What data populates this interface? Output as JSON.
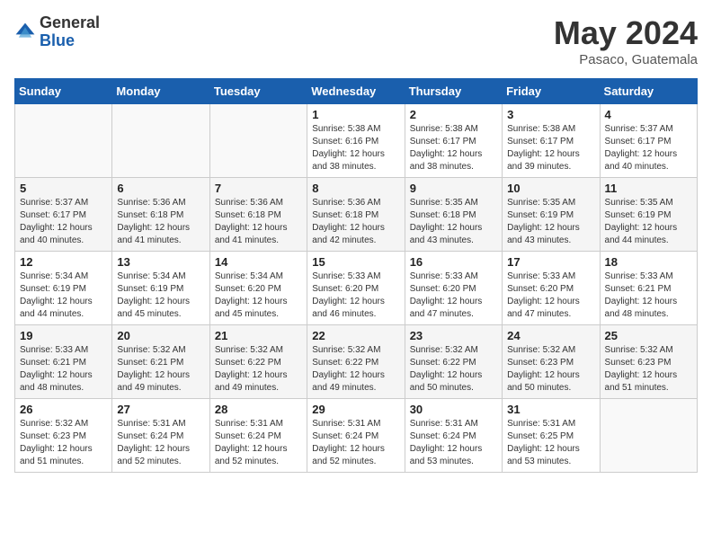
{
  "logo": {
    "general": "General",
    "blue": "Blue"
  },
  "title": "May 2024",
  "location": "Pasaco, Guatemala",
  "headers": [
    "Sunday",
    "Monday",
    "Tuesday",
    "Wednesday",
    "Thursday",
    "Friday",
    "Saturday"
  ],
  "weeks": [
    [
      {
        "day": "",
        "info": ""
      },
      {
        "day": "",
        "info": ""
      },
      {
        "day": "",
        "info": ""
      },
      {
        "day": "1",
        "info": "Sunrise: 5:38 AM\nSunset: 6:16 PM\nDaylight: 12 hours\nand 38 minutes."
      },
      {
        "day": "2",
        "info": "Sunrise: 5:38 AM\nSunset: 6:17 PM\nDaylight: 12 hours\nand 38 minutes."
      },
      {
        "day": "3",
        "info": "Sunrise: 5:38 AM\nSunset: 6:17 PM\nDaylight: 12 hours\nand 39 minutes."
      },
      {
        "day": "4",
        "info": "Sunrise: 5:37 AM\nSunset: 6:17 PM\nDaylight: 12 hours\nand 40 minutes."
      }
    ],
    [
      {
        "day": "5",
        "info": "Sunrise: 5:37 AM\nSunset: 6:17 PM\nDaylight: 12 hours\nand 40 minutes."
      },
      {
        "day": "6",
        "info": "Sunrise: 5:36 AM\nSunset: 6:18 PM\nDaylight: 12 hours\nand 41 minutes."
      },
      {
        "day": "7",
        "info": "Sunrise: 5:36 AM\nSunset: 6:18 PM\nDaylight: 12 hours\nand 41 minutes."
      },
      {
        "day": "8",
        "info": "Sunrise: 5:36 AM\nSunset: 6:18 PM\nDaylight: 12 hours\nand 42 minutes."
      },
      {
        "day": "9",
        "info": "Sunrise: 5:35 AM\nSunset: 6:18 PM\nDaylight: 12 hours\nand 43 minutes."
      },
      {
        "day": "10",
        "info": "Sunrise: 5:35 AM\nSunset: 6:19 PM\nDaylight: 12 hours\nand 43 minutes."
      },
      {
        "day": "11",
        "info": "Sunrise: 5:35 AM\nSunset: 6:19 PM\nDaylight: 12 hours\nand 44 minutes."
      }
    ],
    [
      {
        "day": "12",
        "info": "Sunrise: 5:34 AM\nSunset: 6:19 PM\nDaylight: 12 hours\nand 44 minutes."
      },
      {
        "day": "13",
        "info": "Sunrise: 5:34 AM\nSunset: 6:19 PM\nDaylight: 12 hours\nand 45 minutes."
      },
      {
        "day": "14",
        "info": "Sunrise: 5:34 AM\nSunset: 6:20 PM\nDaylight: 12 hours\nand 45 minutes."
      },
      {
        "day": "15",
        "info": "Sunrise: 5:33 AM\nSunset: 6:20 PM\nDaylight: 12 hours\nand 46 minutes."
      },
      {
        "day": "16",
        "info": "Sunrise: 5:33 AM\nSunset: 6:20 PM\nDaylight: 12 hours\nand 47 minutes."
      },
      {
        "day": "17",
        "info": "Sunrise: 5:33 AM\nSunset: 6:20 PM\nDaylight: 12 hours\nand 47 minutes."
      },
      {
        "day": "18",
        "info": "Sunrise: 5:33 AM\nSunset: 6:21 PM\nDaylight: 12 hours\nand 48 minutes."
      }
    ],
    [
      {
        "day": "19",
        "info": "Sunrise: 5:33 AM\nSunset: 6:21 PM\nDaylight: 12 hours\nand 48 minutes."
      },
      {
        "day": "20",
        "info": "Sunrise: 5:32 AM\nSunset: 6:21 PM\nDaylight: 12 hours\nand 49 minutes."
      },
      {
        "day": "21",
        "info": "Sunrise: 5:32 AM\nSunset: 6:22 PM\nDaylight: 12 hours\nand 49 minutes."
      },
      {
        "day": "22",
        "info": "Sunrise: 5:32 AM\nSunset: 6:22 PM\nDaylight: 12 hours\nand 49 minutes."
      },
      {
        "day": "23",
        "info": "Sunrise: 5:32 AM\nSunset: 6:22 PM\nDaylight: 12 hours\nand 50 minutes."
      },
      {
        "day": "24",
        "info": "Sunrise: 5:32 AM\nSunset: 6:23 PM\nDaylight: 12 hours\nand 50 minutes."
      },
      {
        "day": "25",
        "info": "Sunrise: 5:32 AM\nSunset: 6:23 PM\nDaylight: 12 hours\nand 51 minutes."
      }
    ],
    [
      {
        "day": "26",
        "info": "Sunrise: 5:32 AM\nSunset: 6:23 PM\nDaylight: 12 hours\nand 51 minutes."
      },
      {
        "day": "27",
        "info": "Sunrise: 5:31 AM\nSunset: 6:24 PM\nDaylight: 12 hours\nand 52 minutes."
      },
      {
        "day": "28",
        "info": "Sunrise: 5:31 AM\nSunset: 6:24 PM\nDaylight: 12 hours\nand 52 minutes."
      },
      {
        "day": "29",
        "info": "Sunrise: 5:31 AM\nSunset: 6:24 PM\nDaylight: 12 hours\nand 52 minutes."
      },
      {
        "day": "30",
        "info": "Sunrise: 5:31 AM\nSunset: 6:24 PM\nDaylight: 12 hours\nand 53 minutes."
      },
      {
        "day": "31",
        "info": "Sunrise: 5:31 AM\nSunset: 6:25 PM\nDaylight: 12 hours\nand 53 minutes."
      },
      {
        "day": "",
        "info": ""
      }
    ]
  ]
}
